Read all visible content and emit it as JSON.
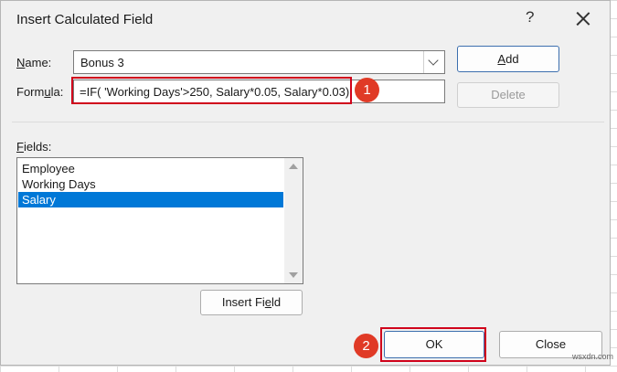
{
  "dialog": {
    "title": "Insert Calculated Field",
    "help_glyph": "?",
    "name_label": "Name:",
    "name_value": "Bonus 3",
    "formula_label": "Formula:",
    "formula_value": "=IF( 'Working Days'>250, Salary*0.05, Salary*0.03)",
    "fields_label": "Fields:",
    "fields": [
      "Employee",
      "Working Days",
      "Salary"
    ],
    "selected_field": "Salary"
  },
  "buttons": {
    "add": "Add",
    "delete": "Delete",
    "insert_field": "Insert Field",
    "ok": "OK",
    "close": "Close"
  },
  "annotations": {
    "step1": "1",
    "step2": "2",
    "highlight_color": "#d0021b",
    "badge_color": "#e03a26"
  },
  "watermark": "wsxdn.com"
}
